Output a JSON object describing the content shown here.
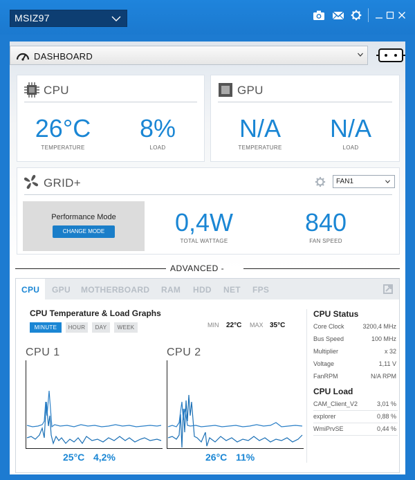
{
  "titlebar": {
    "profile": "MSIZ97",
    "icons": [
      "camera-icon",
      "mail-icon",
      "gear-icon"
    ],
    "window_buttons": [
      "minimize",
      "maximize",
      "close"
    ]
  },
  "dashboard": {
    "label": "DASHBOARD"
  },
  "cpu_card": {
    "title": "CPU",
    "temperature": "26°C",
    "temperature_label": "TEMPERATURE",
    "load": "8%",
    "load_label": "LOAD"
  },
  "gpu_card": {
    "title": "GPU",
    "temperature": "N/A",
    "temperature_label": "TEMPERATURE",
    "load": "N/A",
    "load_label": "LOAD"
  },
  "grid_card": {
    "title": "GRID+",
    "fan_select": "FAN1",
    "performance_mode": "Performance Mode",
    "change_mode_button": "CHANGE MODE",
    "total_wattage": "0,4W",
    "total_wattage_label": "TOTAL WATTAGE",
    "fan_speed": "840",
    "fan_speed_label": "FAN SPEED"
  },
  "advanced": {
    "label": "ADVANCED -",
    "tabs": [
      "CPU",
      "GPU",
      "MOTHERBOARD",
      "RAM",
      "HDD",
      "NET",
      "FPS"
    ],
    "active_tab": "CPU"
  },
  "graphs": {
    "title": "CPU Temperature & Load Graphs",
    "ranges": [
      "MINUTE",
      "HOUR",
      "DAY",
      "WEEK"
    ],
    "active_range": "MINUTE",
    "min_label": "MIN",
    "min_value": "22°C",
    "max_label": "MAX",
    "max_value": "35°C",
    "cpu1": {
      "label": "CPU 1",
      "temp": "25°C",
      "load": "4,2%"
    },
    "cpu2": {
      "label": "CPU 2",
      "temp": "26°C",
      "load": "11%"
    }
  },
  "cpu_status": {
    "title": "CPU Status",
    "rows": [
      {
        "key": "Core Clock",
        "value": "3200,4 MHz"
      },
      {
        "key": "Bus Speed",
        "value": "100 MHz"
      },
      {
        "key": "Multiplier",
        "value": "x 32"
      },
      {
        "key": "Voltage",
        "value": "1,11 V"
      },
      {
        "key": "FanRPM",
        "value": "N/A RPM"
      }
    ]
  },
  "cpu_load": {
    "title": "CPU Load",
    "rows": [
      {
        "key": "CAM_Client_V2",
        "value": "3,01 %"
      },
      {
        "key": "explorer",
        "value": "0,88 %"
      },
      {
        "key": "WmiPrvSE",
        "value": "0,44 %"
      }
    ]
  },
  "colors": {
    "accent": "#1a86d4",
    "titlebar": "#1b79cf",
    "profile_bg": "#0d3e72"
  }
}
